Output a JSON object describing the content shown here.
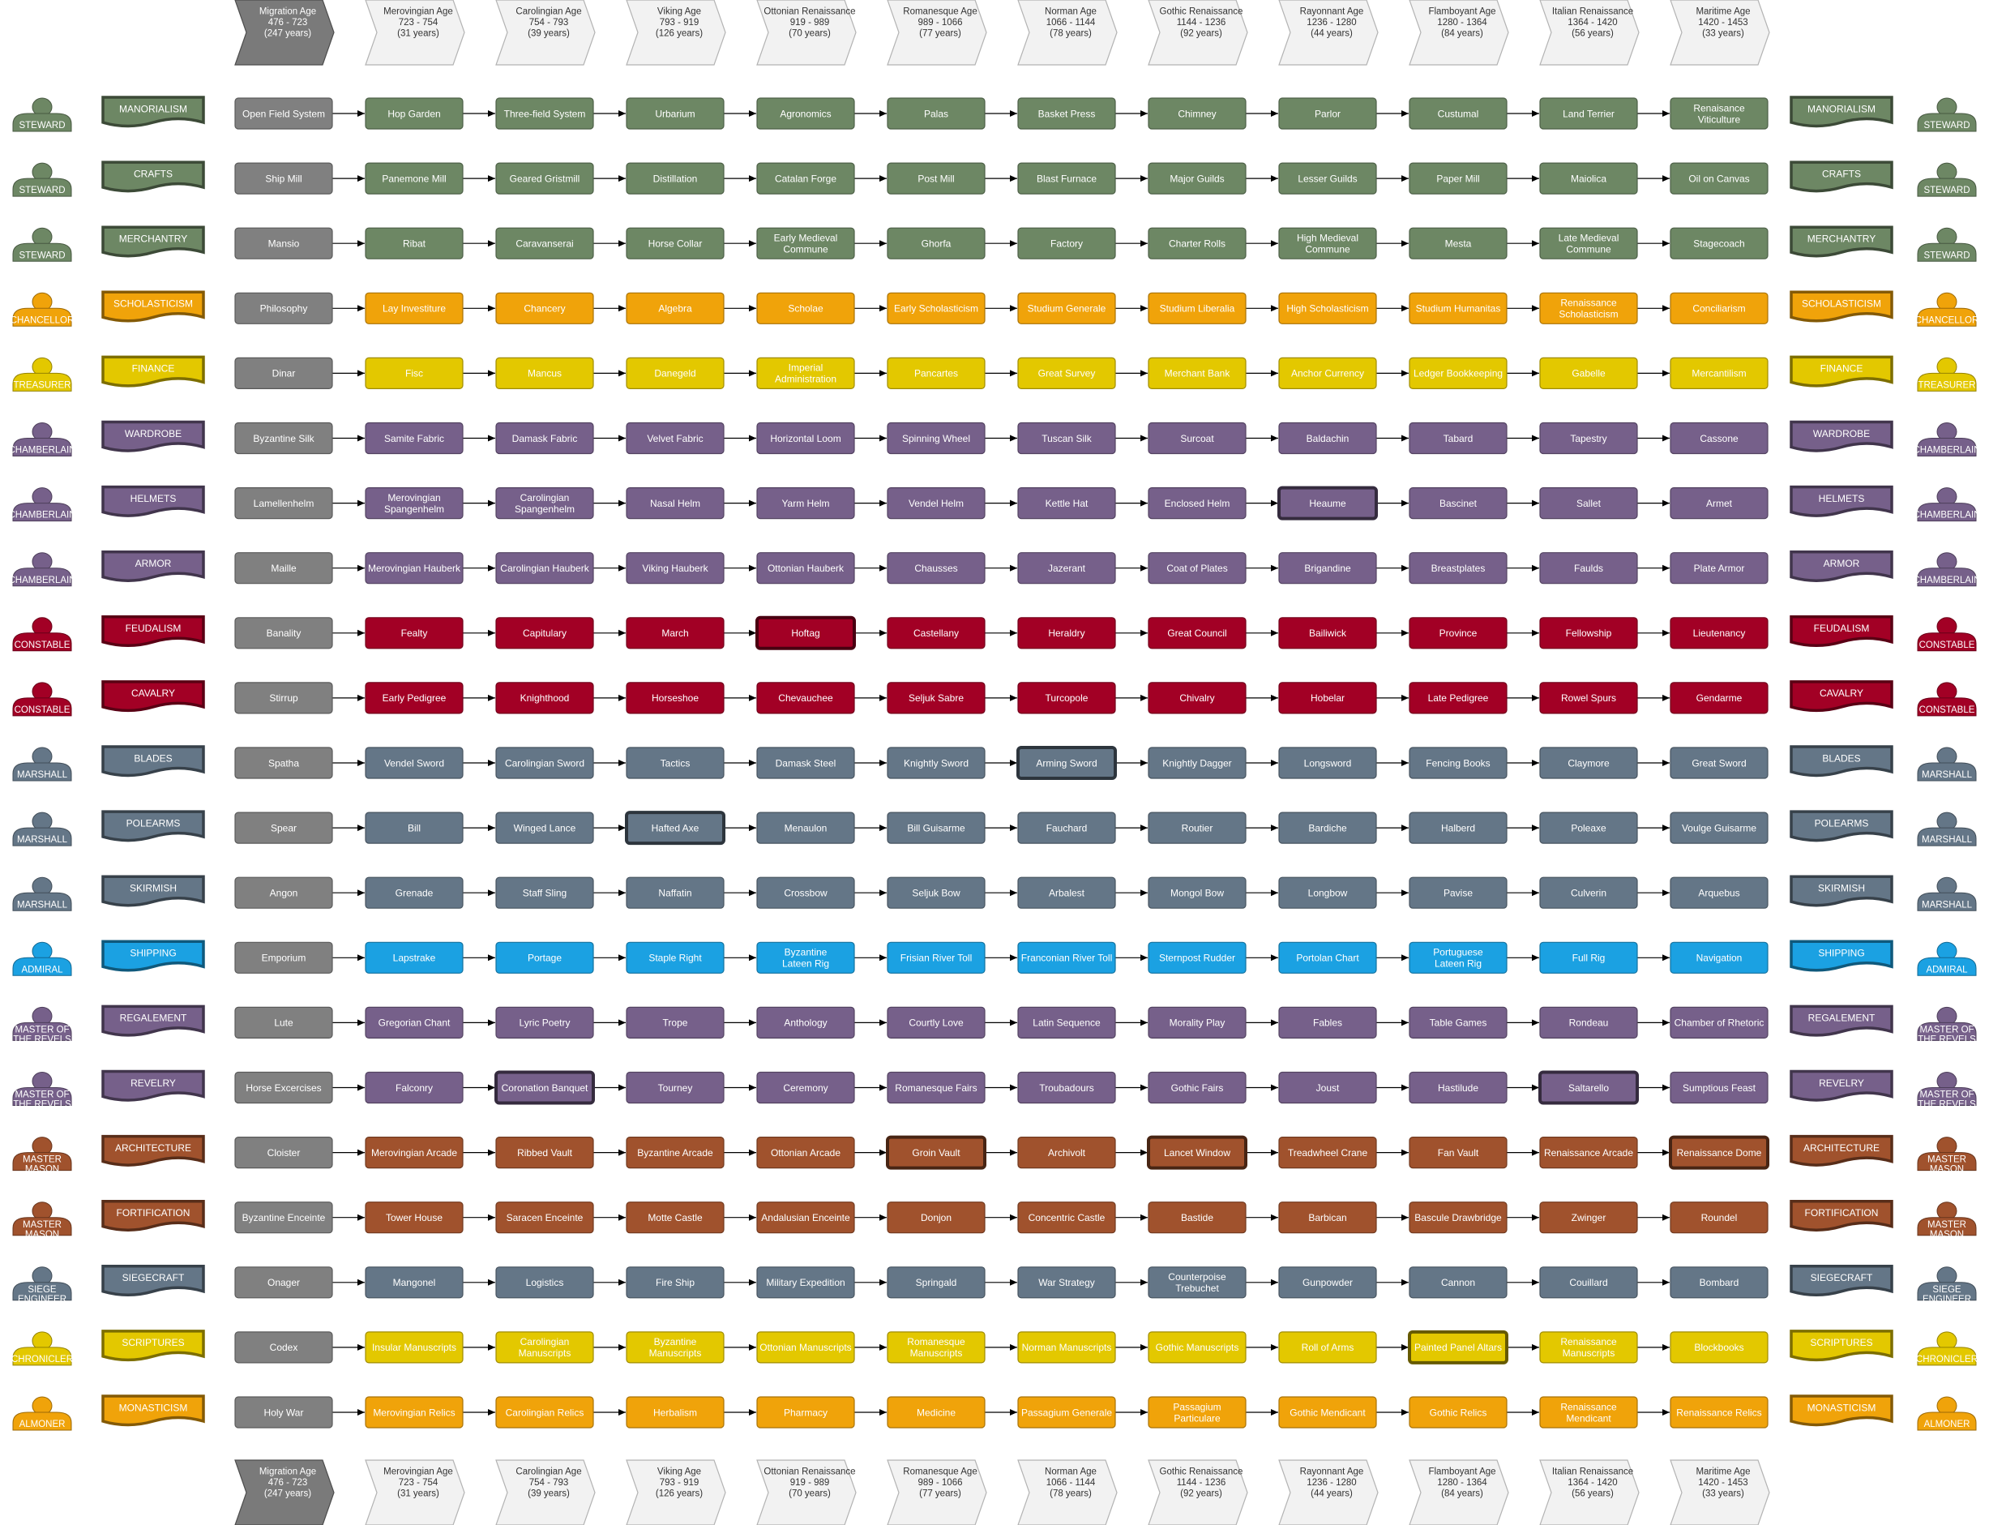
{
  "colors": {
    "green": "#6D8764",
    "orange": "#F0A30A",
    "yellow": "#E3C800",
    "purple": "#76608A",
    "red": "#A20025",
    "slate": "#647687",
    "blue": "#1BA1E2",
    "brown": "#A0522D",
    "gray": "#808080"
  },
  "ages": [
    {
      "name": "Migration Age",
      "range": "476 - 723",
      "years": "(247 years)"
    },
    {
      "name": "Merovingian Age",
      "range": "723 - 754",
      "years": "(31 years)"
    },
    {
      "name": "Carolingian Age",
      "range": "754 - 793",
      "years": "(39 years)"
    },
    {
      "name": "Viking Age",
      "range": "793 - 919",
      "years": "(126 years)"
    },
    {
      "name": "Ottonian Renaissance",
      "range": "919 - 989",
      "years": "(70 years)"
    },
    {
      "name": "Romanesque Age",
      "range": "989 - 1066",
      "years": "(77 years)"
    },
    {
      "name": "Norman Age",
      "range": "1066 - 1144",
      "years": "(78 years)"
    },
    {
      "name": "Gothic Renaissance",
      "range": "1144 - 1236",
      "years": "(92 years)"
    },
    {
      "name": "Rayonnant Age",
      "range": "1236 - 1280",
      "years": "(44 years)"
    },
    {
      "name": "Flamboyant Age",
      "range": "1280 - 1364",
      "years": "(84 years)"
    },
    {
      "name": "Italian Renaissance",
      "range": "1364 - 1420",
      "years": "(56 years)"
    },
    {
      "name": "Maritime Age",
      "range": "1420 - 1453",
      "years": "(33 years)"
    }
  ],
  "rows": [
    {
      "official": "STEWARD",
      "category": "MANORIALISM",
      "color": "green",
      "emph": [],
      "techs": [
        "Open Field System",
        "Hop Garden",
        "Three-field System",
        "Urbarium",
        "Agronomics",
        "Palas",
        "Basket Press",
        "Chimney",
        "Parlor",
        "Custumal",
        "Land Terrier",
        "Renaisance\nViticulture"
      ]
    },
    {
      "official": "STEWARD",
      "category": "CRAFTS",
      "color": "green",
      "emph": [],
      "techs": [
        "Ship Mill",
        "Panemone Mill",
        "Geared Gristmill",
        "Distillation",
        "Catalan Forge",
        "Post Mill",
        "Blast Furnace",
        "Major Guilds",
        "Lesser Guilds",
        "Paper Mill",
        "Maiolica",
        "Oil on Canvas"
      ]
    },
    {
      "official": "STEWARD",
      "category": "MERCHANTRY",
      "color": "green",
      "emph": [],
      "techs": [
        "Mansio",
        "Ribat",
        "Caravanserai",
        "Horse Collar",
        "Early Medieval\nCommune",
        "Ghorfa",
        "Factory",
        "Charter Rolls",
        "High Medieval\nCommune",
        "Mesta",
        "Late Medieval\nCommune",
        "Stagecoach"
      ]
    },
    {
      "official": "CHANCELLOR",
      "category": "SCHOLASTICISM",
      "color": "orange",
      "emph": [],
      "techs": [
        "Philosophy",
        "Lay Investiture",
        "Chancery",
        "Algebra",
        "Scholae",
        "Early Scholasticism",
        "Studium Generale",
        "Studium Liberalia",
        "High Scholasticism",
        "Studium Humanitas",
        "Renaissance\nScholasticism",
        "Conciliarism"
      ]
    },
    {
      "official": "TREASURER",
      "category": "FINANCE",
      "color": "yellow",
      "emph": [],
      "techs": [
        "Dinar",
        "Fisc",
        "Mancus",
        "Danegeld",
        "Imperial\nAdministration",
        "Pancartes",
        "Great Survey",
        "Merchant Bank",
        "Anchor Currency",
        "Ledger Bookkeeping",
        "Gabelle",
        "Mercantilism"
      ]
    },
    {
      "official": "CHAMBERLAIN",
      "category": "WARDROBE",
      "color": "purple",
      "emph": [],
      "techs": [
        "Byzantine Silk",
        "Samite Fabric",
        "Damask Fabric",
        "Velvet Fabric",
        "Horizontal Loom",
        "Spinning Wheel",
        "Tuscan Silk",
        "Surcoat",
        "Baldachin",
        "Tabard",
        "Tapestry",
        "Cassone"
      ]
    },
    {
      "official": "CHAMBERLAIN",
      "category": "HELMETS",
      "color": "purple",
      "emph": [
        8
      ],
      "techs": [
        "Lamellenhelm",
        "Merovingian\nSpangenhelm",
        "Carolingian\nSpangenhelm",
        "Nasal Helm",
        "Yarm Helm",
        "Vendel Helm",
        "Kettle Hat",
        "Enclosed Helm",
        "Heaume",
        "Bascinet",
        "Sallet",
        "Armet"
      ]
    },
    {
      "official": "CHAMBERLAIN",
      "category": "ARMOR",
      "color": "purple",
      "emph": [],
      "techs": [
        "Maille",
        "Merovingian Hauberk",
        "Carolingian Hauberk",
        "Viking Hauberk",
        "Ottonian Hauberk",
        "Chausses",
        "Jazerant",
        "Coat of Plates",
        "Brigandine",
        "Breastplates",
        "Faulds",
        "Plate Armor"
      ]
    },
    {
      "official": "CONSTABLE",
      "category": "FEUDALISM",
      "color": "red",
      "emph": [
        4
      ],
      "techs": [
        "Banality",
        "Fealty",
        "Capitulary",
        "March",
        "Hoftag",
        "Castellany",
        "Heraldry",
        "Great Council",
        "Bailiwick",
        "Province",
        "Fellowship",
        "Lieutenancy"
      ]
    },
    {
      "official": "CONSTABLE",
      "category": "CAVALRY",
      "color": "red",
      "emph": [],
      "techs": [
        "Stirrup",
        "Early Pedigree",
        "Knighthood",
        "Horseshoe",
        "Chevauchee",
        "Seljuk Sabre",
        "Turcopole",
        "Chivalry",
        "Hobelar",
        "Late Pedigree",
        "Rowel Spurs",
        "Gendarme"
      ]
    },
    {
      "official": "MARSHALL",
      "category": "BLADES",
      "color": "slate",
      "emph": [
        6
      ],
      "techs": [
        "Spatha",
        "Vendel Sword",
        "Carolingian Sword",
        "Tactics",
        "Damask Steel",
        "Knightly Sword",
        "Arming Sword",
        "Knightly Dagger",
        "Longsword",
        "Fencing Books",
        "Claymore",
        "Great Sword"
      ]
    },
    {
      "official": "MARSHALL",
      "category": "POLEARMS",
      "color": "slate",
      "emph": [
        3
      ],
      "techs": [
        "Spear",
        "Bill",
        "Winged Lance",
        "Hafted Axe",
        "Menaulon",
        "Bill Guisarme",
        "Fauchard",
        "Routier",
        "Bardiche",
        "Halberd",
        "Poleaxe",
        "Voulge Guisarme"
      ]
    },
    {
      "official": "MARSHALL",
      "category": "SKIRMISH",
      "color": "slate",
      "emph": [],
      "techs": [
        "Angon",
        "Grenade",
        "Staff Sling",
        "Naffatin",
        "Crossbow",
        "Seljuk Bow",
        "Arbalest",
        "Mongol Bow",
        "Longbow",
        "Pavise",
        "Culverin",
        "Arquebus"
      ]
    },
    {
      "official": "ADMIRAL",
      "category": "SHIPPING",
      "color": "blue",
      "emph": [],
      "techs": [
        "Emporium",
        "Lapstrake",
        "Portage",
        "Staple Right",
        "Byzantine\nLateen Rig",
        "Frisian River Toll",
        "Franconian River Toll",
        "Sternpost Rudder",
        "Portolan Chart",
        "Portuguese\nLateen Rig",
        "Full Rig",
        "Navigation"
      ]
    },
    {
      "official": "MASTER OF\nTHE REVELS",
      "category": "REGALEMENT",
      "color": "purple",
      "emph": [],
      "techs": [
        "Lute",
        "Gregorian Chant",
        "Lyric Poetry",
        "Trope",
        "Anthology",
        "Courtly Love",
        "Latin Sequence",
        "Morality Play",
        "Fables",
        "Table Games",
        "Rondeau",
        "Chamber of Rhetoric"
      ]
    },
    {
      "official": "MASTER OF\nTHE REVELS",
      "category": "REVELRY",
      "color": "purple",
      "emph": [
        2,
        10
      ],
      "techs": [
        "Horse Excercises",
        "Falconry",
        "Coronation Banquet",
        "Tourney",
        "Ceremony",
        "Romanesque Fairs",
        "Troubadours",
        "Gothic Fairs",
        "Joust",
        "Hastilude",
        "Saltarello",
        "Sumptious Feast"
      ]
    },
    {
      "official": "MASTER\nMASON",
      "category": "ARCHITECTURE",
      "color": "brown",
      "emph": [
        5,
        7,
        11
      ],
      "techs": [
        "Cloister",
        "Merovingian Arcade",
        "Ribbed Vault",
        "Byzantine Arcade",
        "Ottonian Arcade",
        "Groin Vault",
        "Archivolt",
        "Lancet Window",
        "Treadwheel Crane",
        "Fan Vault",
        "Renaissance Arcade",
        "Renaissance Dome"
      ]
    },
    {
      "official": "MASTER\nMASON",
      "category": "FORTIFICATION",
      "color": "brown",
      "emph": [],
      "techs": [
        "Byzantine Enceinte",
        "Tower House",
        "Saracen Enceinte",
        "Motte Castle",
        "Andalusian Enceinte",
        "Donjon",
        "Concentric Castle",
        "Bastide",
        "Barbican",
        "Bascule Drawbridge",
        "Zwinger",
        "Roundel"
      ]
    },
    {
      "official": "SIEGE\nENGINEER",
      "category": "SIEGECRAFT",
      "color": "slate",
      "emph": [],
      "techs": [
        "Onager",
        "Mangonel",
        "Logistics",
        "Fire Ship",
        "Military Expedition",
        "Springald",
        "War Strategy",
        "Counterpoise\nTrebuchet",
        "Gunpowder",
        "Cannon",
        "Couillard",
        "Bombard"
      ]
    },
    {
      "official": "CHRONICLER",
      "category": "SCRIPTURES",
      "color": "yellow",
      "emph": [
        9
      ],
      "techs": [
        "Codex",
        "Insular Manuscripts",
        "Carolingian\nManuscripts",
        "Byzantine\nManuscripts",
        "Ottonian Manuscripts",
        "Romanesque\nManuscripts",
        "Norman Manuscripts",
        "Gothic Manuscripts",
        "Roll of Arms",
        "Painted Panel Altars",
        "Renaissance\nManuscripts",
        "Blockbooks"
      ]
    },
    {
      "official": "ALMONER",
      "category": "MONASTICISM",
      "color": "orange",
      "emph": [],
      "techs": [
        "Holy War",
        "Merovingian Relics",
        "Carolingian Relics",
        "Herbalism",
        "Pharmacy",
        "Medicine",
        "Passagium Generale",
        "Passagium\nParticulare",
        "Gothic Mendicant",
        "Gothic Relics",
        "Renaissance\nMendicant",
        "Renaissance Relics"
      ]
    }
  ]
}
